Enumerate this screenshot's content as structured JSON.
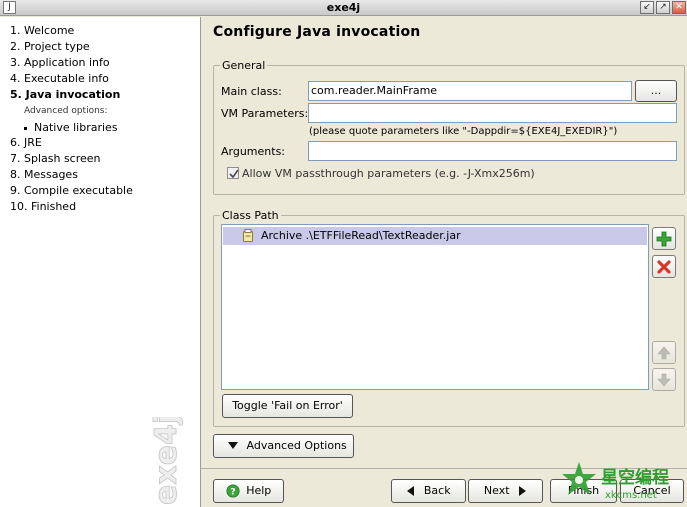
{
  "window": {
    "title": "exe4j"
  },
  "steps": [
    {
      "label": "1. Welcome"
    },
    {
      "label": "2. Project type"
    },
    {
      "label": "3. Application info"
    },
    {
      "label": "4. Executable info"
    },
    {
      "label": "5. Java invocation",
      "active": true
    },
    {
      "label": "Advanced options:"
    },
    {
      "label": "Native libraries"
    },
    {
      "label": "6. JRE"
    },
    {
      "label": "7. Splash screen"
    },
    {
      "label": "8. Messages"
    },
    {
      "label": "9. Compile executable"
    },
    {
      "label": "10. Finished"
    }
  ],
  "brand": {
    "text": "exe4j"
  },
  "page": {
    "heading": "Configure Java invocation"
  },
  "general": {
    "title": "General",
    "main_class_label": "Main class:",
    "main_class_value": "com.reader.MainFrame",
    "browse_label": "...",
    "vm_params_label": "VM Parameters:",
    "vm_params_value": "",
    "vm_hint": "(please quote parameters like \"-Dappdir=${EXE4J_EXEDIR}\")",
    "arguments_label": "Arguments:",
    "arguments_value": "",
    "allow_passthrough_label": "Allow VM passthrough parameters (e.g. -J-Xmx256m)",
    "allow_passthrough_checked": true
  },
  "classpath": {
    "title": "Class Path",
    "entries": [
      {
        "text": "Archive .\\ETFFileRead\\TextReader.jar",
        "selected": true
      }
    ],
    "toggle_label": "Toggle 'Fail on Error'",
    "add_icon": "plus-icon",
    "remove_icon": "x-icon",
    "up_icon": "arrow-up-icon",
    "down_icon": "arrow-down-icon"
  },
  "advanced_label": "Advanced Options",
  "footer": {
    "help_label": "Help",
    "back_label": "Back",
    "next_label": "Next",
    "finish_label": "Finish",
    "cancel_label": "Cancel"
  },
  "watermark": {
    "cn_text": "星空编程",
    "url": "xkcms.net"
  },
  "colors": {
    "accent_green": "#2f9e2f",
    "selection": "#c8c8e8",
    "remove_red": "#d83a2a"
  }
}
